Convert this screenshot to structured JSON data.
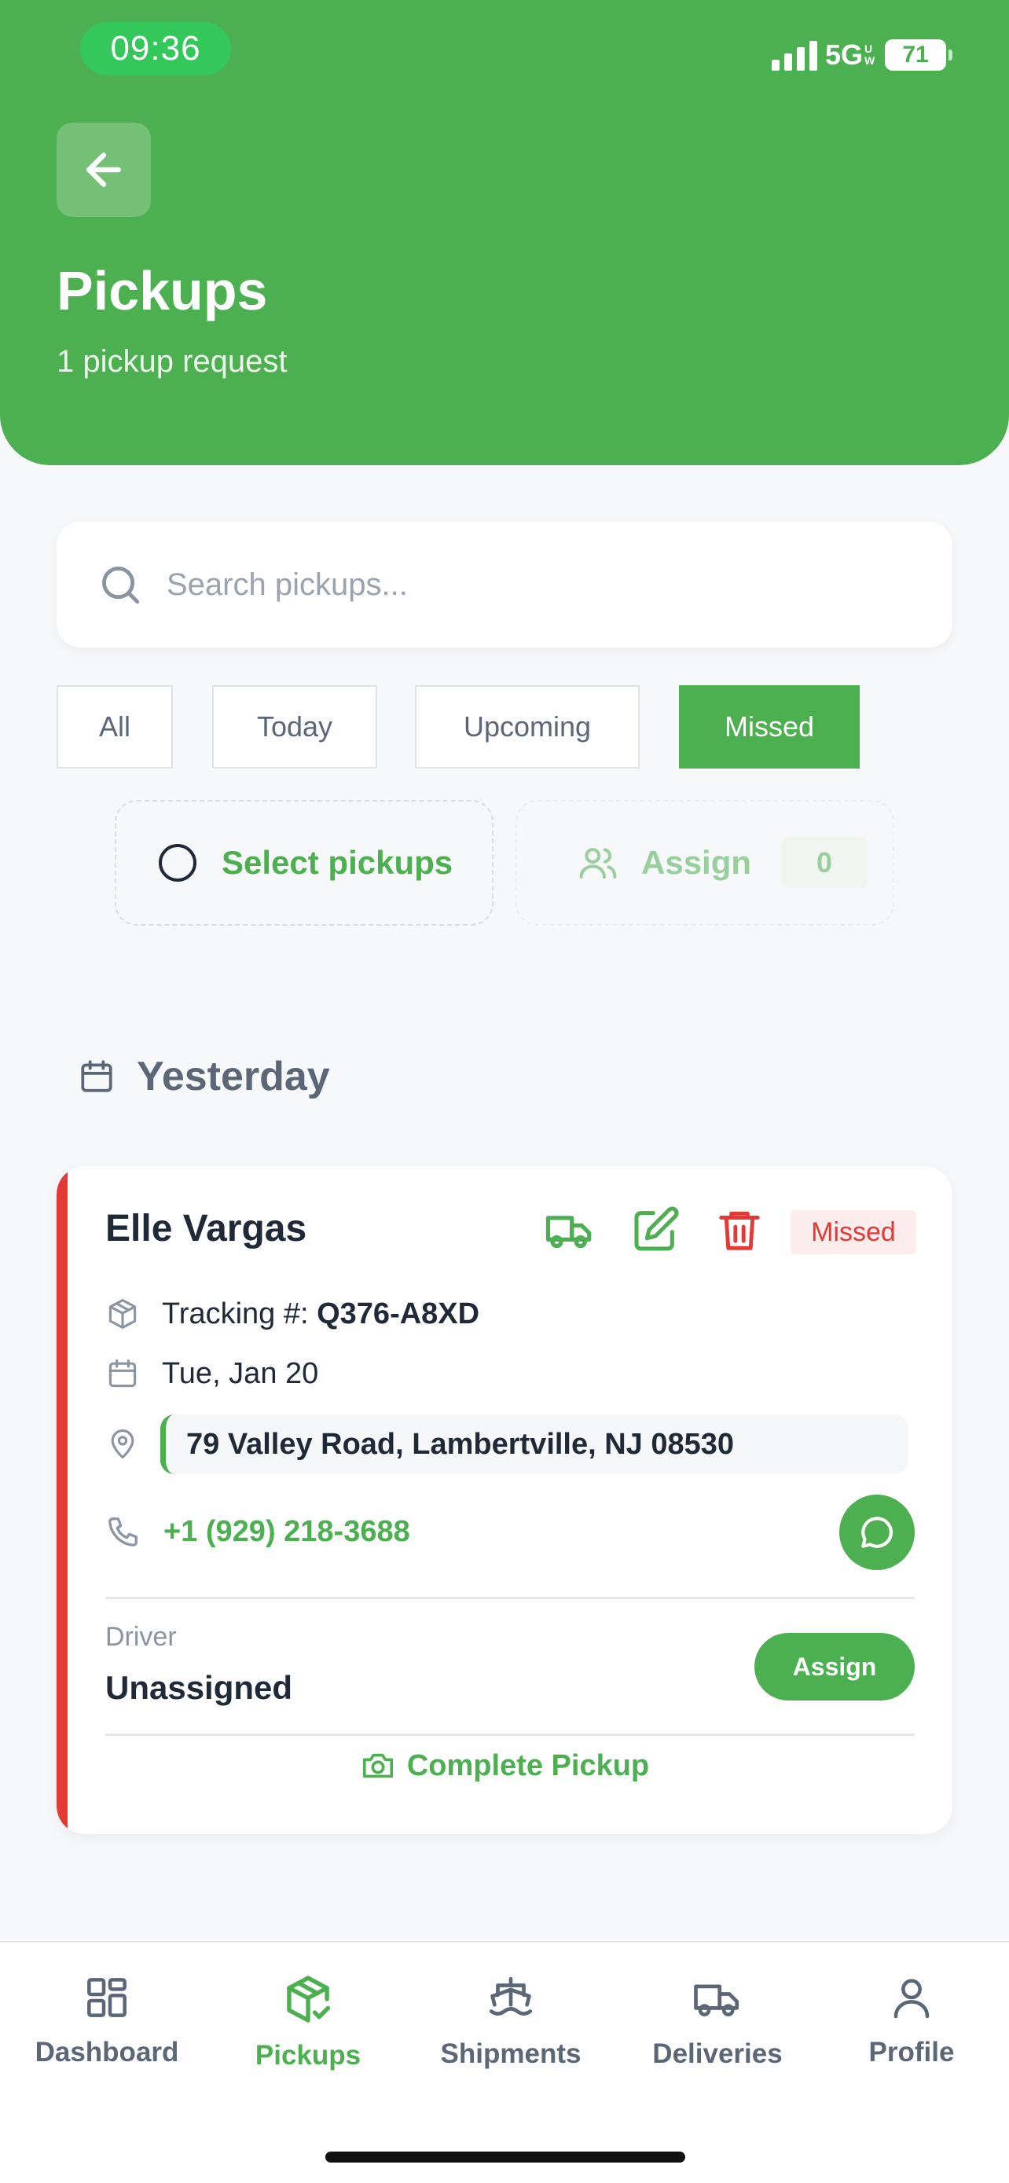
{
  "status_bar": {
    "time": "09:36",
    "network": "5G",
    "network_sup": "UW",
    "battery": "71"
  },
  "header": {
    "title": "Pickups",
    "subtitle": "1 pickup request"
  },
  "search": {
    "placeholder": "Search pickups..."
  },
  "filters": [
    {
      "label": "All",
      "active": false
    },
    {
      "label": "Today",
      "active": false
    },
    {
      "label": "Upcoming",
      "active": false
    },
    {
      "label": "Missed",
      "active": true
    }
  ],
  "selection": {
    "select_label": "Select pickups",
    "assign_label": "Assign",
    "assign_count": "0"
  },
  "section": {
    "title": "Yesterday"
  },
  "pickup": {
    "customer": "Elle Vargas",
    "status": "Missed",
    "tracking_prefix": "Tracking #: ",
    "tracking": "Q376-A8XD",
    "date": "Tue, Jan 20",
    "address": "79 Valley Road, Lambertville, NJ 08530",
    "phone": "+1 (929) 218-3688",
    "driver_label": "Driver",
    "driver_value": "Unassigned",
    "assign_button": "Assign",
    "complete_button": "Complete Pickup"
  },
  "bottom_nav": [
    {
      "label": "Dashboard",
      "icon": "grid-icon",
      "active": false
    },
    {
      "label": "Pickups",
      "icon": "package-check-icon",
      "active": true
    },
    {
      "label": "Shipments",
      "icon": "ship-icon",
      "active": false
    },
    {
      "label": "Deliveries",
      "icon": "truck-icon",
      "active": false
    },
    {
      "label": "Profile",
      "icon": "user-icon",
      "active": false
    }
  ],
  "colors": {
    "primary": "#4caf50",
    "danger": "#e53935",
    "muted": "#5b6676"
  }
}
